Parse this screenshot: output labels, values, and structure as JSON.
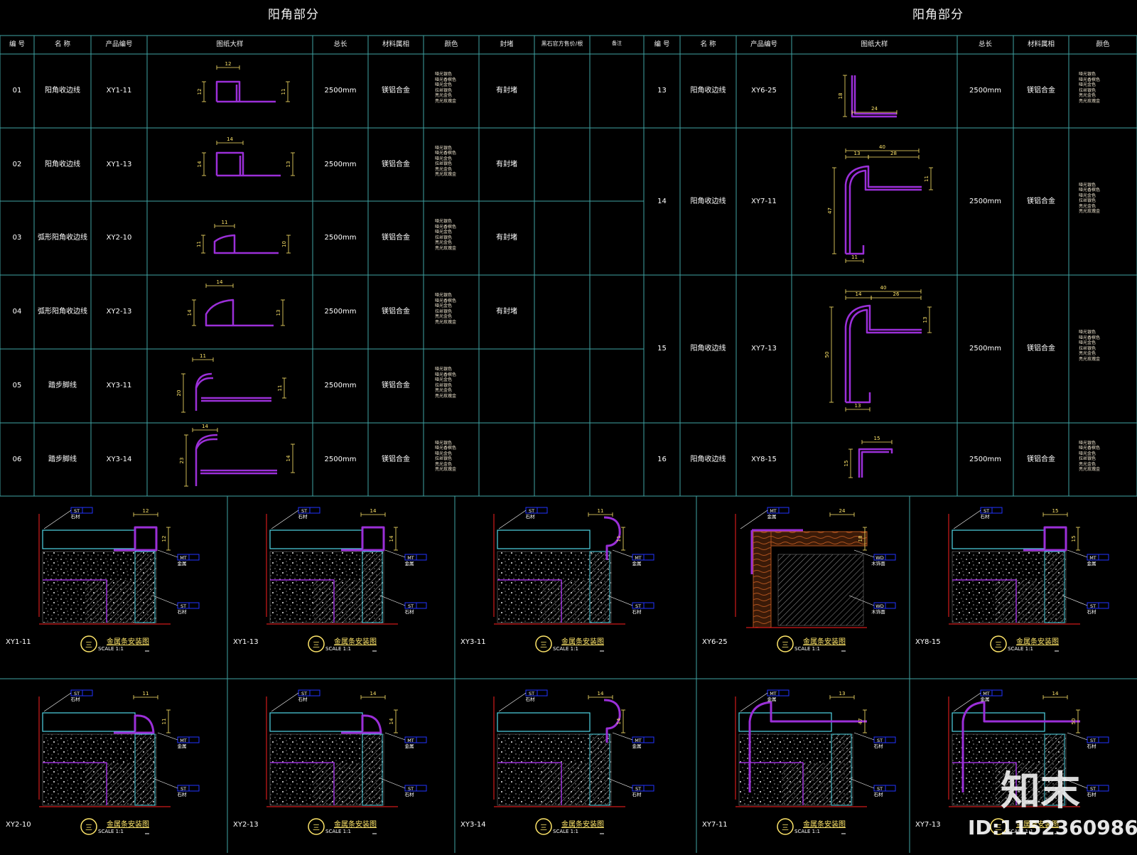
{
  "titles": {
    "left": "阳角部分",
    "right": "阳角部分"
  },
  "headers_left": [
    "编 号",
    "名 称",
    "产品编号",
    "图纸大样",
    "总长",
    "材料属相",
    "颜色",
    "封堵",
    "黑石官方售价/根",
    "备注"
  ],
  "headers_right": [
    "编 号",
    "名 称",
    "产品编号",
    "图纸大样",
    "总长",
    "材料属相",
    "颜色"
  ],
  "color_list": [
    "哑光银色",
    "哑光香槟色",
    "哑光金色",
    "拉丝银色",
    "亮光金色",
    "亮光玫瑰金"
  ],
  "rows_left": [
    {
      "no": "01",
      "name": "阳角收边线",
      "code": "XY1-11",
      "length": "2500mm",
      "material": "镁铝合金",
      "seal": "有封堵",
      "dims": [
        "12",
        "12",
        "11"
      ]
    },
    {
      "no": "02",
      "name": "阳角收边线",
      "code": "XY1-13",
      "length": "2500mm",
      "material": "镁铝合金",
      "seal": "有封堵",
      "dims": [
        "14",
        "14",
        "13"
      ]
    },
    {
      "no": "03",
      "name": "弧形阳角收边线",
      "code": "XY2-10",
      "length": "2500mm",
      "material": "镁铝合金",
      "seal": "有封堵",
      "dims": [
        "11",
        "11",
        "10"
      ]
    },
    {
      "no": "04",
      "name": "弧形阳角收边线",
      "code": "XY2-13",
      "length": "2500mm",
      "material": "镁铝合金",
      "seal": "有封堵",
      "dims": [
        "14",
        "14",
        "13"
      ]
    },
    {
      "no": "05",
      "name": "踏步脚线",
      "code": "XY3-11",
      "length": "2500mm",
      "material": "镁铝合金",
      "seal": "",
      "dims": [
        "11",
        "20",
        "11"
      ]
    },
    {
      "no": "06",
      "name": "踏步脚线",
      "code": "XY3-14",
      "length": "2500mm",
      "material": "镁铝合金",
      "seal": "",
      "dims": [
        "14",
        "23",
        "14"
      ]
    }
  ],
  "rows_right": [
    {
      "no": "13",
      "name": "阳角收边线",
      "code": "XY6-25",
      "length": "2500mm",
      "material": "镁铝合金",
      "dims": [
        "18",
        "24"
      ]
    },
    {
      "no": "14",
      "name": "阳角收边线",
      "code": "XY7-11",
      "length": "2500mm",
      "material": "镁铝合金",
      "dims": [
        "40",
        "13",
        "28",
        "11",
        "47",
        "11"
      ]
    },
    {
      "no": "15",
      "name": "阳角收边线",
      "code": "XY7-13",
      "length": "2500mm",
      "material": "镁铝合金",
      "dims": [
        "40",
        "14",
        "26",
        "13",
        "50",
        "13"
      ]
    },
    {
      "no": "16",
      "name": "阳角收边线",
      "code": "XY8-15",
      "length": "2500mm",
      "material": "镁铝合金",
      "dims": [
        "15",
        "15"
      ]
    }
  ],
  "details": [
    {
      "code": "XY1-11",
      "dims": [
        "12",
        "12"
      ],
      "tags": [
        "ST",
        "MT",
        "ST"
      ],
      "tag_labels": [
        "石材",
        "金属",
        "石材"
      ]
    },
    {
      "code": "XY1-13",
      "dims": [
        "14",
        "14"
      ],
      "tags": [
        "ST",
        "MT",
        "ST"
      ],
      "tag_labels": [
        "石材",
        "金属",
        "石材"
      ]
    },
    {
      "code": "XY3-11",
      "dims": [
        "11",
        "11"
      ],
      "tags": [
        "ST",
        "MT",
        "ST"
      ],
      "tag_labels": [
        "石材",
        "金属",
        "石材"
      ]
    },
    {
      "code": "XY6-25",
      "dims": [
        "24",
        "18"
      ],
      "tags": [
        "MT",
        "WD",
        "WD"
      ],
      "tag_labels": [
        "金属",
        "木饰面",
        "木饰面"
      ]
    },
    {
      "code": "XY8-15",
      "dims": [
        "15",
        "15"
      ],
      "tags": [
        "ST",
        "MT",
        "ST"
      ],
      "tag_labels": [
        "石材",
        "金属",
        "石材"
      ]
    },
    {
      "code": "XY2-10",
      "dims": [
        "11",
        "11"
      ],
      "tags": [
        "ST",
        "MT",
        "ST"
      ],
      "tag_labels": [
        "石材",
        "金属",
        "石材"
      ]
    },
    {
      "code": "XY2-13",
      "dims": [
        "14",
        "14"
      ],
      "tags": [
        "ST",
        "MT",
        "ST"
      ],
      "tag_labels": [
        "石材",
        "金属",
        "石材"
      ]
    },
    {
      "code": "XY3-14",
      "dims": [
        "14",
        "14"
      ],
      "tags": [
        "ST",
        "MT",
        "ST"
      ],
      "tag_labels": [
        "石材",
        "金属",
        "石材"
      ]
    },
    {
      "code": "XY7-11",
      "dims": [
        "13",
        "47"
      ],
      "tags": [
        "MT",
        "ST",
        "ST"
      ],
      "tag_labels": [
        "金属",
        "石材",
        "石材"
      ]
    },
    {
      "code": "XY7-13",
      "dims": [
        "14",
        "50"
      ],
      "tags": [
        "MT",
        "ST",
        "ST"
      ],
      "tag_labels": [
        "金属",
        "石材",
        "石材"
      ]
    }
  ],
  "detail_title": "金属条安装图",
  "detail_scale": "SCALE 1:1",
  "detail_symbol": "三",
  "watermark": {
    "logo": "知末",
    "id": "ID:1152360986"
  },
  "colors": {
    "grid": "#3fa3a3",
    "profile": "#9b2fd8",
    "dim": "#ffe66a",
    "text": "#ffffff",
    "stone": "#cfcfcf",
    "tag": "#2233ff",
    "cyan": "#4fd6e6",
    "wood": "#b0531e",
    "red": "#d01a1a"
  }
}
